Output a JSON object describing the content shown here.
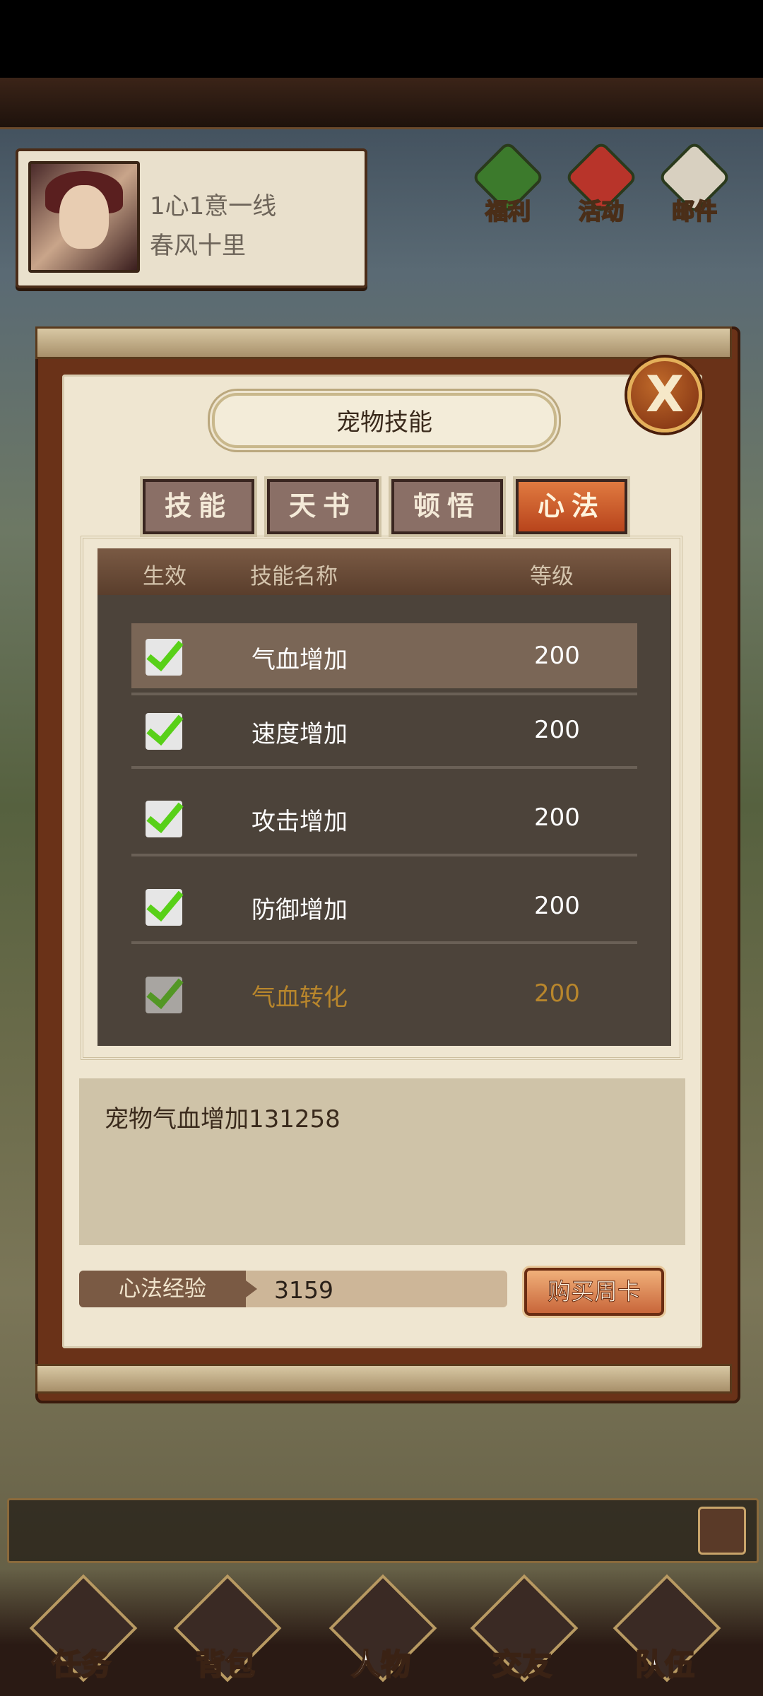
{
  "player": {
    "line1": "1心1意一线",
    "line2": "春风十里"
  },
  "top_icons": [
    {
      "label": "福利",
      "icon": "welfare-icon",
      "color": "#3c7a2c"
    },
    {
      "label": "活动",
      "icon": "gift-icon",
      "color": "#b8342a"
    },
    {
      "label": "邮件",
      "icon": "mail-icon",
      "color": "#d8d0c0"
    }
  ],
  "dialog": {
    "title": "宠物技能",
    "close": "X",
    "tabs": [
      {
        "label": "技能",
        "active": false
      },
      {
        "label": "天书",
        "active": false
      },
      {
        "label": "顿悟",
        "active": false
      },
      {
        "label": "心法",
        "active": true
      }
    ],
    "table": {
      "headers": {
        "effect": "生效",
        "name": "技能名称",
        "level": "等级"
      },
      "rows": [
        {
          "checked": true,
          "name": "气血增加",
          "level": "200",
          "selected": true
        },
        {
          "checked": true,
          "name": "速度增加",
          "level": "200"
        },
        {
          "checked": true,
          "name": "攻击增加",
          "level": "200"
        },
        {
          "checked": true,
          "name": "防御增加",
          "level": "200"
        },
        {
          "checked": true,
          "name": "气血转化",
          "level": "200"
        }
      ]
    },
    "description": "宠物气血增加131258",
    "exp": {
      "label": "心法经验",
      "value": "3159"
    },
    "buy_button": "购买周卡"
  },
  "bottom_nav": [
    {
      "label": "任务",
      "icon": "scroll-icon"
    },
    {
      "label": "背包",
      "icon": "chest-icon"
    },
    {
      "label": "人物",
      "icon": "character-icon"
    },
    {
      "label": "交友",
      "icon": "smiley-icon"
    },
    {
      "label": "队伍",
      "icon": "flag-icon"
    }
  ]
}
